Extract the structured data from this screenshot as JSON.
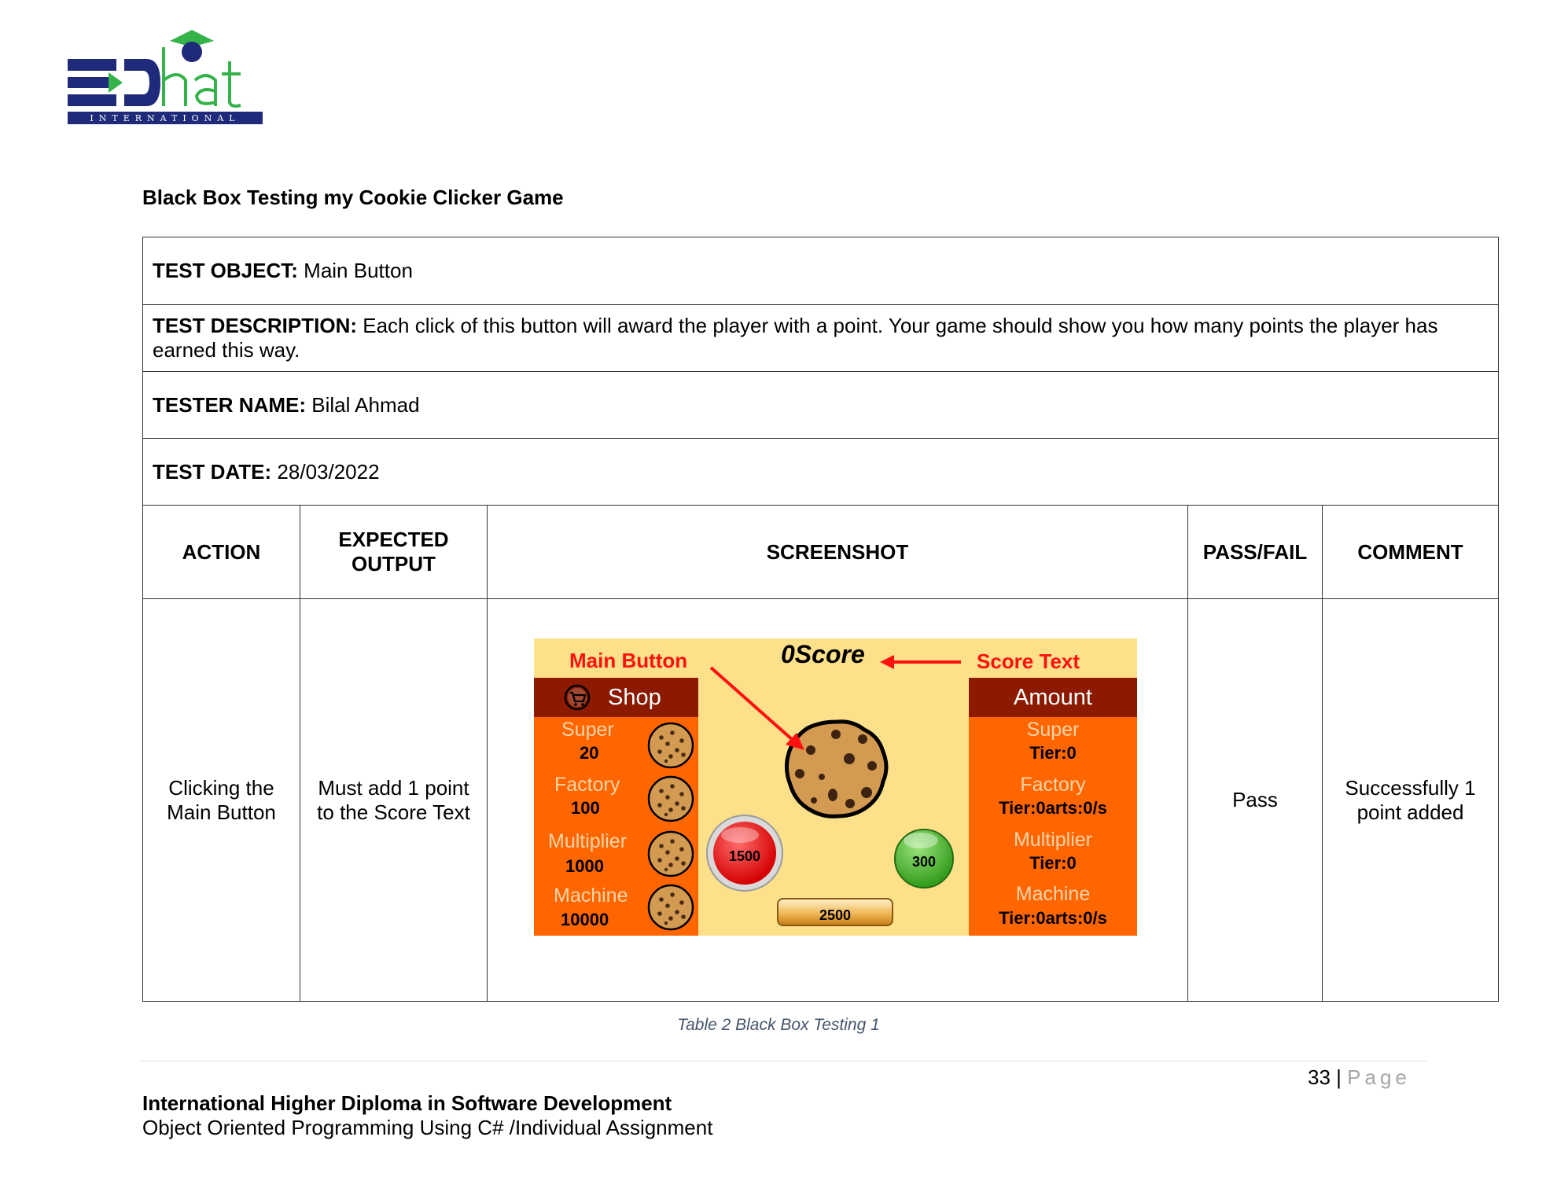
{
  "logo": {
    "wordmark": "EDhat",
    "sub": "INTERNATIONAL"
  },
  "doc_title": "Black Box Testing my Cookie Clicker Game",
  "info": {
    "object_label": "TEST OBJECT:",
    "object_value": "Main Button",
    "description_label": "TEST DESCRIPTION:",
    "description_value": "Each click of this button will award the player with a point. Your game should show you how many points the player has earned this way.",
    "tester_label": "TESTER NAME:",
    "tester_value": "Bilal Ahmad",
    "date_label": "TEST DATE:",
    "date_value": "28/03/2022"
  },
  "headers": {
    "action": "ACTION",
    "expected_line1": "EXPECTED",
    "expected_line2": "OUTPUT",
    "screenshot": "SCREENSHOT",
    "pass_fail": "PASS/FAIL",
    "comment": "COMMENT"
  },
  "row": {
    "action_line1": "Clicking the",
    "action_line2": "Main Button",
    "expected_line1": "Must add 1 point",
    "expected_line2": "to the Score Text",
    "result": "Pass",
    "comment_line1": "Successfully 1",
    "comment_line2": "point added"
  },
  "game": {
    "annotation_main": "Main Button",
    "annotation_score": "Score Text",
    "score_text": "0Score",
    "shop_title": "Shop",
    "amount_title": "Amount",
    "shop_items": [
      {
        "name": "Super",
        "price": "20"
      },
      {
        "name": "Factory",
        "price": "100"
      },
      {
        "name": "Multiplier",
        "price": "1000"
      },
      {
        "name": "Machine",
        "price": "10000"
      }
    ],
    "amount_items": [
      {
        "name": "Super",
        "value": "Tier:0"
      },
      {
        "name": "Factory",
        "value": "Tier:0arts:0/s"
      },
      {
        "name": "Multiplier",
        "value": "Tier:0"
      },
      {
        "name": "Machine",
        "value": "Tier:0arts:0/s"
      }
    ],
    "red_button": "1500",
    "green_button": "300",
    "bar_button": "2500",
    "colors": {
      "panel": "#ff6600",
      "panel_header": "#8b1a00",
      "background": "#fde08a",
      "annotation": "#ff1010"
    }
  },
  "caption": "Table 2 Black Box Testing 1",
  "footer": {
    "page_number": "33",
    "separator": "|",
    "page_word": "Page",
    "line1": "International Higher Diploma in Software Development",
    "line2": "Object Oriented Programming Using C# /Individual Assignment"
  }
}
